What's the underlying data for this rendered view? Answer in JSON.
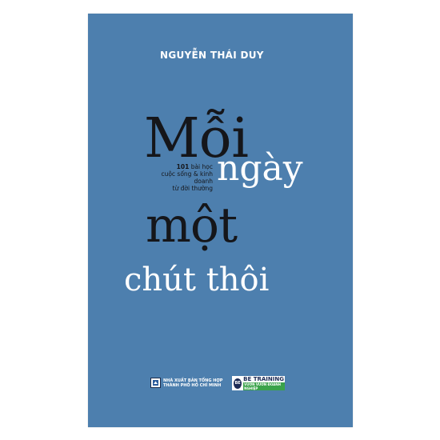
{
  "cover": {
    "author": "NGUYỄN THÁI DUY",
    "title_line1": "Mỗi",
    "title_line2": "ngày",
    "title_line3": "một",
    "title_line4": "chút thôi",
    "tagline_number": "101",
    "tagline_rest1": " bài học",
    "tagline_line2": "cuộc sống & kinh doanh",
    "tagline_line3": "từ đời thường",
    "publisher_line1": "NHÀ XUẤT BẢN TỔNG HỢP",
    "publisher_line2": "THÀNH PHỐ HỒ CHÍ MINH",
    "partner_badge": "BE",
    "partner_name": "BE TRAINING",
    "partner_slogan": "VƯƠN VƯƠN ĐOANH NGHIỆP"
  },
  "colors": {
    "cover_blue": "#4d7fae",
    "title_dark": "#15161a",
    "title_white": "#ffffff",
    "partner_green": "#3aa24a"
  }
}
